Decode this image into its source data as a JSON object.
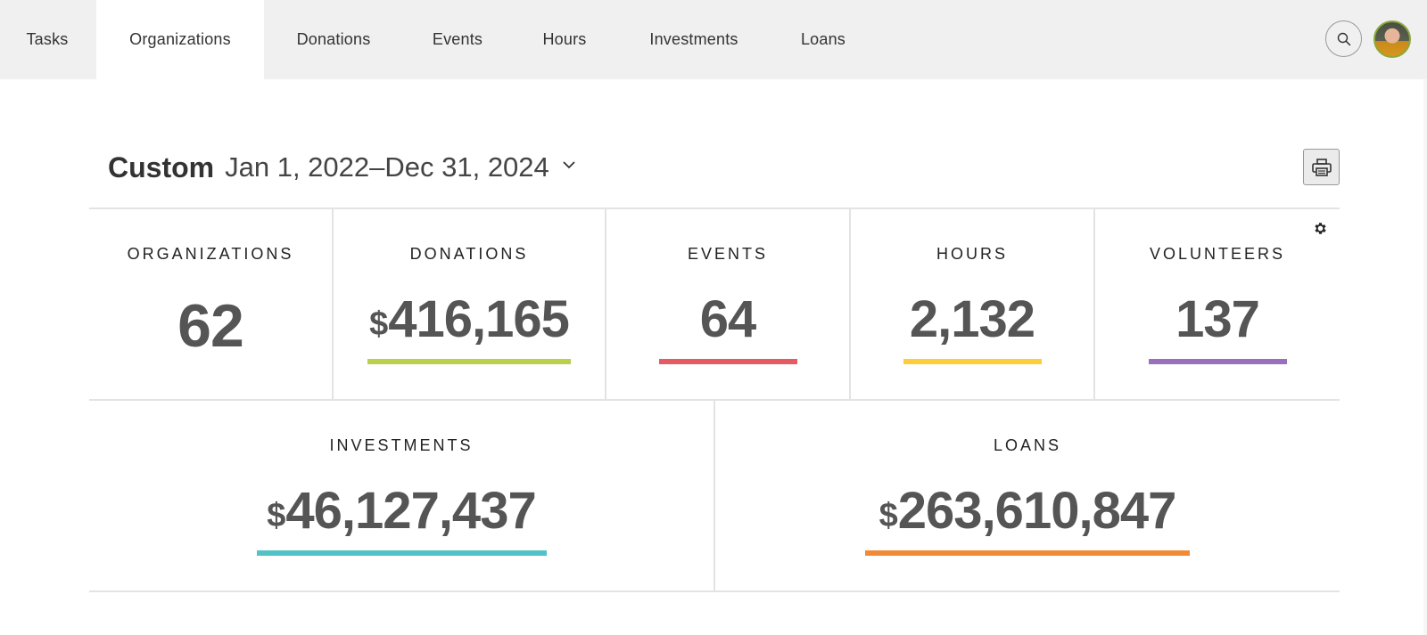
{
  "nav": {
    "tabs": [
      {
        "label": "Tasks",
        "active": false
      },
      {
        "label": "Organizations",
        "active": true
      },
      {
        "label": "Donations",
        "active": false
      },
      {
        "label": "Events",
        "active": false
      },
      {
        "label": "Hours",
        "active": false
      },
      {
        "label": "Investments",
        "active": false
      },
      {
        "label": "Loans",
        "active": false
      }
    ],
    "search_icon": "search-icon",
    "avatar_icon": "user-avatar"
  },
  "date_filter": {
    "preset": "Custom",
    "range": "Jan 1, 2022–Dec 31, 2024",
    "dropdown_icon": "chevron-down-icon"
  },
  "toolbar": {
    "print_icon": "printer-icon",
    "settings_icon": "gear-icon"
  },
  "stats": {
    "organizations": {
      "label": "Organizations",
      "value": "62",
      "currency": "",
      "color": ""
    },
    "donations": {
      "label": "Donations",
      "value": "416,165",
      "currency": "$",
      "color": "#b8d04a"
    },
    "events": {
      "label": "Events",
      "value": "64",
      "currency": "",
      "color": "#e65a64"
    },
    "hours": {
      "label": "Hours",
      "value": "2,132",
      "currency": "",
      "color": "#fecd3a"
    },
    "volunteers": {
      "label": "Volunteers",
      "value": "137",
      "currency": "",
      "color": "#9a6fbd"
    },
    "investments": {
      "label": "Investments",
      "value": "46,127,437",
      "currency": "$",
      "color": "#50c2c8"
    },
    "loans": {
      "label": "Loans",
      "value": "263,610,847",
      "currency": "$",
      "color": "#f28935"
    }
  }
}
